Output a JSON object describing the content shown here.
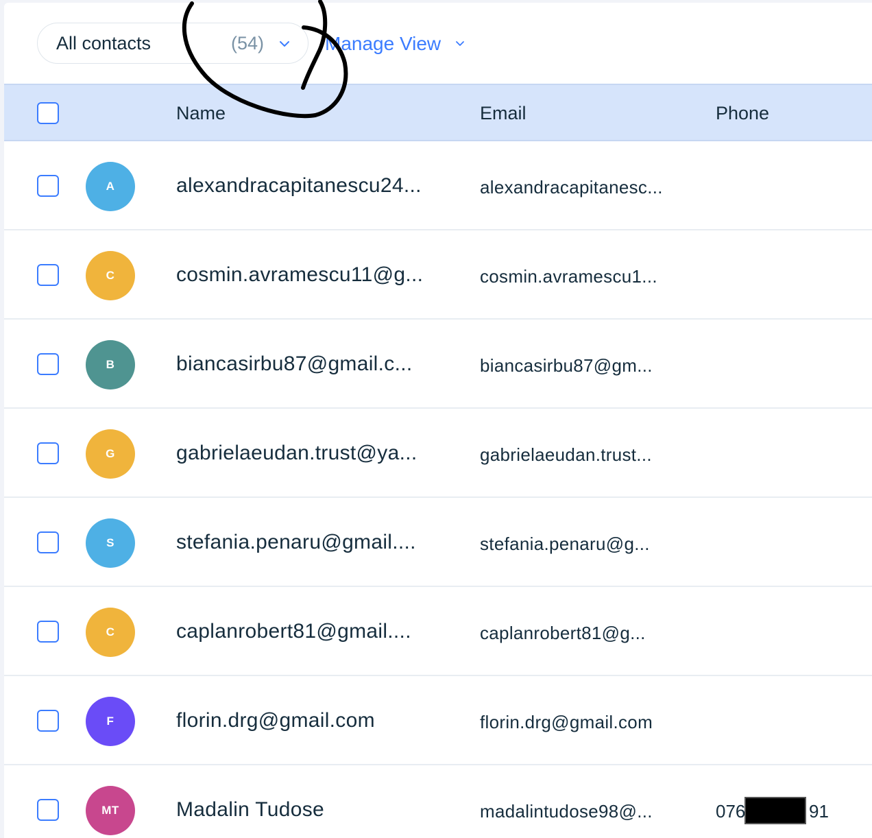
{
  "toolbar": {
    "view_label": "All contacts",
    "view_count": "(54)",
    "manage_label": "Manage View"
  },
  "table": {
    "columns": [
      "Name",
      "Email",
      "Phone"
    ],
    "rows": [
      {
        "initials": "A",
        "color": "#4eb0e5",
        "name": "alexandracapitanescu24...",
        "email": "alexandracapitanesc...",
        "phone": ""
      },
      {
        "initials": "C",
        "color": "#f0b43c",
        "name": "cosmin.avramescu11@g...",
        "email": "cosmin.avramescu1...",
        "phone": ""
      },
      {
        "initials": "B",
        "color": "#4f9491",
        "name": "biancasirbu87@gmail.c...",
        "email": "biancasirbu87@gm...",
        "phone": ""
      },
      {
        "initials": "G",
        "color": "#f0b43c",
        "name": "gabrielaeudan.trust@ya...",
        "email": "gabrielaeudan.trust...",
        "phone": ""
      },
      {
        "initials": "S",
        "color": "#4eb0e5",
        "name": "stefania.penaru@gmail....",
        "email": "stefania.penaru@g...",
        "phone": ""
      },
      {
        "initials": "C",
        "color": "#f0b43c",
        "name": "caplanrobert81@gmail....",
        "email": "caplanrobert81@g...",
        "phone": ""
      },
      {
        "initials": "F",
        "color": "#6a4cf7",
        "name": "florin.drg@gmail.com",
        "email": "florin.drg@gmail.com",
        "phone": ""
      },
      {
        "initials": "MT",
        "color": "#c8478e",
        "name": "Madalin Tudose",
        "email": "madalintudose98@...",
        "phone": "076",
        "phone_end": "91"
      }
    ]
  }
}
